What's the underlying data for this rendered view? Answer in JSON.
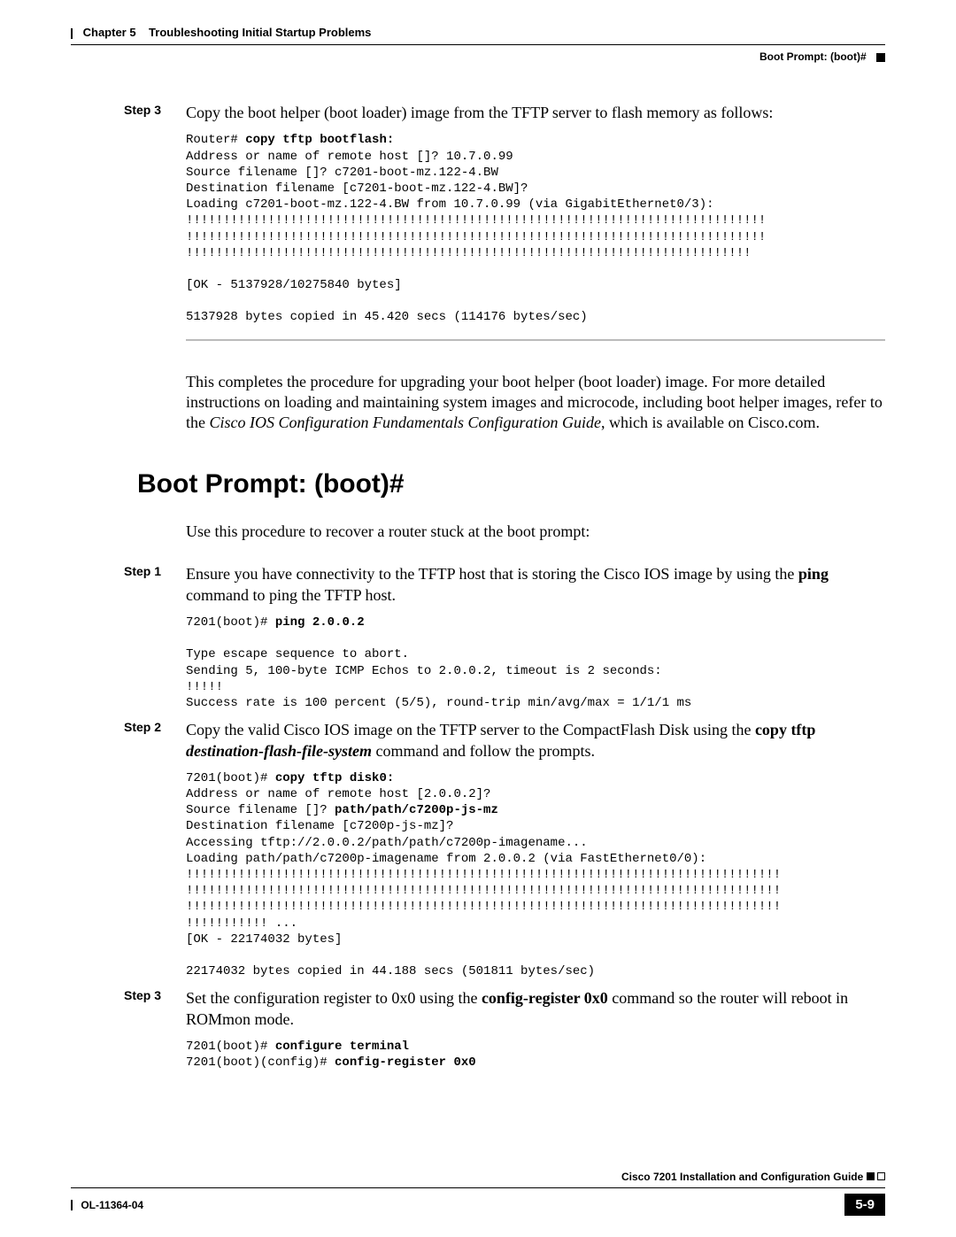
{
  "header": {
    "chapter_label": "Chapter 5",
    "chapter_title": "Troubleshooting Initial Startup Problems",
    "section_right": "Boot Prompt: (boot)#"
  },
  "step3a": {
    "label": "Step 3",
    "text": "Copy the boot helper (boot loader) image from the TFTP server to flash memory as follows:"
  },
  "code3a": {
    "prompt": "Router# ",
    "cmd": "copy tftp bootflash:",
    "body": "Address or name of remote host []? 10.7.0.99\nSource filename []? c7201-boot-mz.122-4.BW\nDestination filename [c7201-boot-mz.122-4.BW]?\nLoading c7201-boot-mz.122-4.BW from 10.7.0.99 (via GigabitEthernet0/3):\n!!!!!!!!!!!!!!!!!!!!!!!!!!!!!!!!!!!!!!!!!!!!!!!!!!!!!!!!!!!!!!!!!!!!!!!!!!!!!!\n!!!!!!!!!!!!!!!!!!!!!!!!!!!!!!!!!!!!!!!!!!!!!!!!!!!!!!!!!!!!!!!!!!!!!!!!!!!!!!\n!!!!!!!!!!!!!!!!!!!!!!!!!!!!!!!!!!!!!!!!!!!!!!!!!!!!!!!!!!!!!!!!!!!!!!!!!!!!\n\n[OK - 5137928/10275840 bytes]\n\n5137928 bytes copied in 45.420 secs (114176 bytes/sec)"
  },
  "closing_para": {
    "t1": "This completes the procedure for upgrading your boot helper (boot loader) image. For more detailed instructions on loading and maintaining system images and microcode, including boot helper images, refer to the ",
    "ital": "Cisco IOS Configuration Fundamentals Configuration Guide",
    "t2": ", which is available on Cisco.com."
  },
  "section_title": "Boot Prompt: (boot)#",
  "intro": "Use this procedure to recover a router stuck at the boot prompt:",
  "step1": {
    "label": "Step 1",
    "t1": "Ensure you have connectivity to the TFTP host that is storing the Cisco IOS image by using the ",
    "bold": "ping",
    "t2": " command to ping the TFTP host."
  },
  "code1": {
    "prompt": "7201(boot)# ",
    "cmd": "ping 2.0.0.2",
    "body": "Type escape sequence to abort.\nSending 5, 100-byte ICMP Echos to 2.0.0.2, timeout is 2 seconds:\n!!!!!\nSuccess rate is 100 percent (5/5), round-trip min/avg/max = 1/1/1 ms"
  },
  "step2": {
    "label": "Step 2",
    "t1": "Copy the valid Cisco IOS image on the TFTP server to the CompactFlash Disk using the ",
    "bold": "copy tftp ",
    "ital": "destination-flash-file-system",
    "t2": " command and follow the prompts."
  },
  "code2": {
    "prompt1": "7201(boot)# ",
    "cmd1": "copy tftp disk0:",
    "l2": "Address or name of remote host [2.0.0.2]?",
    "l3a": "Source filename []? ",
    "l3b": "path/path/c7200p-js-mz",
    "body": "Destination filename [c7200p-js-mz]?\nAccessing tftp://2.0.0.2/path/path/c7200p-imagename...\nLoading path/path/c7200p-imagename from 2.0.0.2 (via FastEthernet0/0):\n!!!!!!!!!!!!!!!!!!!!!!!!!!!!!!!!!!!!!!!!!!!!!!!!!!!!!!!!!!!!!!!!!!!!!!!!!!!!!!!!\n!!!!!!!!!!!!!!!!!!!!!!!!!!!!!!!!!!!!!!!!!!!!!!!!!!!!!!!!!!!!!!!!!!!!!!!!!!!!!!!!\n!!!!!!!!!!!!!!!!!!!!!!!!!!!!!!!!!!!!!!!!!!!!!!!!!!!!!!!!!!!!!!!!!!!!!!!!!!!!!!!!\n!!!!!!!!!!! ...\n[OK - 22174032 bytes]\n\n22174032 bytes copied in 44.188 secs (501811 bytes/sec)"
  },
  "step3b": {
    "label": "Step 3",
    "t1": "Set the configuration register to 0x0 using the ",
    "bold": "config-register 0x0",
    "t2": " command so the router will reboot in ROMmon mode."
  },
  "code3b": {
    "p1": "7201(boot)# ",
    "c1": "configure terminal",
    "p2": "7201(boot)(config)# ",
    "c2": "config-register 0x0"
  },
  "footer": {
    "doc_title": "Cisco 7201 Installation and Configuration Guide",
    "doc_id": "OL-11364-04",
    "page": "5-9"
  }
}
